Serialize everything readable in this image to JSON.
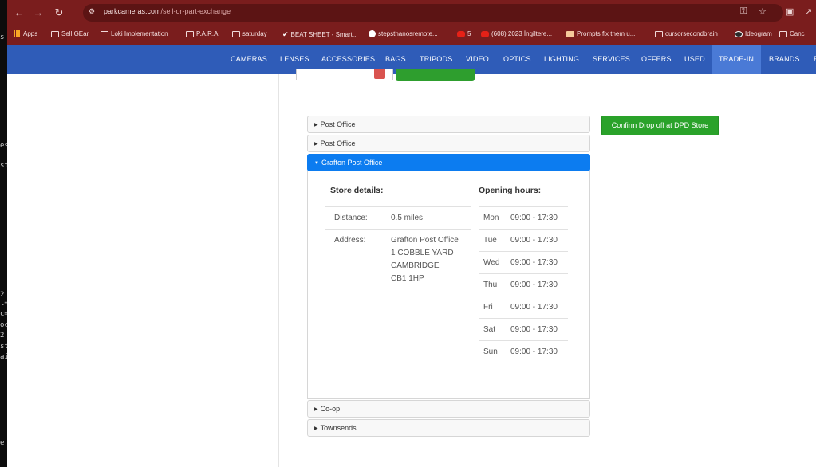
{
  "terminal": {
    "lines": [
      "s",
      "es",
      "st",
      "2",
      "l=",
      "c=",
      "oc",
      "2",
      "st",
      "ai",
      "e"
    ]
  },
  "browser": {
    "url_domain": "parkcameras.com",
    "url_path": "/sell-or-part-exchange",
    "bookmarks": [
      {
        "label": "Apps",
        "icon": "apps-grid-icon"
      },
      {
        "label": "Sell GEar",
        "icon": "folder-icon"
      },
      {
        "label": "Loki Implementation",
        "icon": "folder-icon"
      },
      {
        "label": "P.A.R.A",
        "icon": "folder-icon"
      },
      {
        "label": "saturday",
        "icon": "folder-icon"
      },
      {
        "label": "BEAT SHEET - Smart...",
        "icon": "check-icon"
      },
      {
        "label": "stepsthanosremote...",
        "icon": "github-icon"
      },
      {
        "label": "5",
        "icon": "youtube-icon"
      },
      {
        "label": "(608) 2023 İngiltere...",
        "icon": "youtube-icon"
      },
      {
        "label": "Prompts fix them u...",
        "icon": "image-icon"
      },
      {
        "label": "cursorsecondbrain",
        "icon": "folder-icon"
      },
      {
        "label": "Ideogram",
        "icon": "ideogram-icon"
      },
      {
        "label": "Canc",
        "icon": "folder-icon"
      }
    ]
  },
  "site_nav": {
    "items": [
      "CAMERAS",
      "LENSES",
      "ACCESSORIES",
      "BAGS",
      "TRIPODS",
      "VIDEO",
      "OPTICS",
      "LIGHTING",
      "SERVICES",
      "OFFERS",
      "USED",
      "TRADE-IN",
      "BRANDS",
      "E"
    ],
    "active": "TRADE-IN"
  },
  "stores": {
    "items": [
      "Post Office",
      "Post Office",
      "Grafton Post Office",
      "Co-op",
      "Townsends"
    ],
    "expanded": "Grafton Post Office",
    "confirm_button": "Confirm Drop off at DPD Store"
  },
  "store_details": {
    "heading": "Store details:",
    "distance_label": "Distance:",
    "distance_value": "0.5 miles",
    "address_label": "Address:",
    "address_lines": [
      "Grafton Post Office",
      "1 COBBLE YARD",
      "CAMBRIDGE",
      "CB1 1HP"
    ]
  },
  "opening_hours": {
    "heading": "Opening hours:",
    "days": [
      {
        "day": "Mon",
        "hours": "09:00 - 17:30"
      },
      {
        "day": "Tue",
        "hours": "09:00 - 17:30"
      },
      {
        "day": "Wed",
        "hours": "09:00 - 17:30"
      },
      {
        "day": "Thu",
        "hours": "09:00 - 17:30"
      },
      {
        "day": "Fri",
        "hours": "09:00 - 17:30"
      },
      {
        "day": "Sat",
        "hours": "09:00 - 17:30"
      },
      {
        "day": "Sun",
        "hours": "09:00 - 17:30"
      }
    ]
  }
}
